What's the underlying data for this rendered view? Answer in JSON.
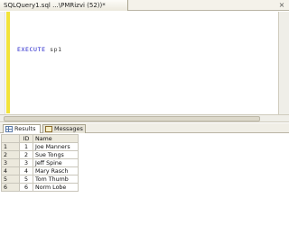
{
  "document_tab": {
    "title": "SQLQuery1.sql ...\\PMRizvi (52))*",
    "close_symbol": "×"
  },
  "editor": {
    "keyword": "EXECUTE",
    "argument": "sp1"
  },
  "results_tabs": [
    {
      "label": "Results",
      "icon": "grid-icon",
      "active": true
    },
    {
      "label": "Messages",
      "icon": "message-icon",
      "active": false
    }
  ],
  "grid": {
    "columns": [
      "ID",
      "Name"
    ],
    "rows": [
      {
        "num": "1",
        "id": "1",
        "name": "Joe Manners"
      },
      {
        "num": "2",
        "id": "2",
        "name": "Sue Tongs"
      },
      {
        "num": "3",
        "id": "3",
        "name": "Jeff Spine"
      },
      {
        "num": "4",
        "id": "4",
        "name": "Mary Rasch"
      },
      {
        "num": "5",
        "id": "5",
        "name": "Tom Thumb"
      },
      {
        "num": "6",
        "id": "6",
        "name": "Norm Lobe"
      }
    ]
  },
  "colors": {
    "keyword": "#1c1cc9",
    "change_bar": "#f2e33a"
  }
}
